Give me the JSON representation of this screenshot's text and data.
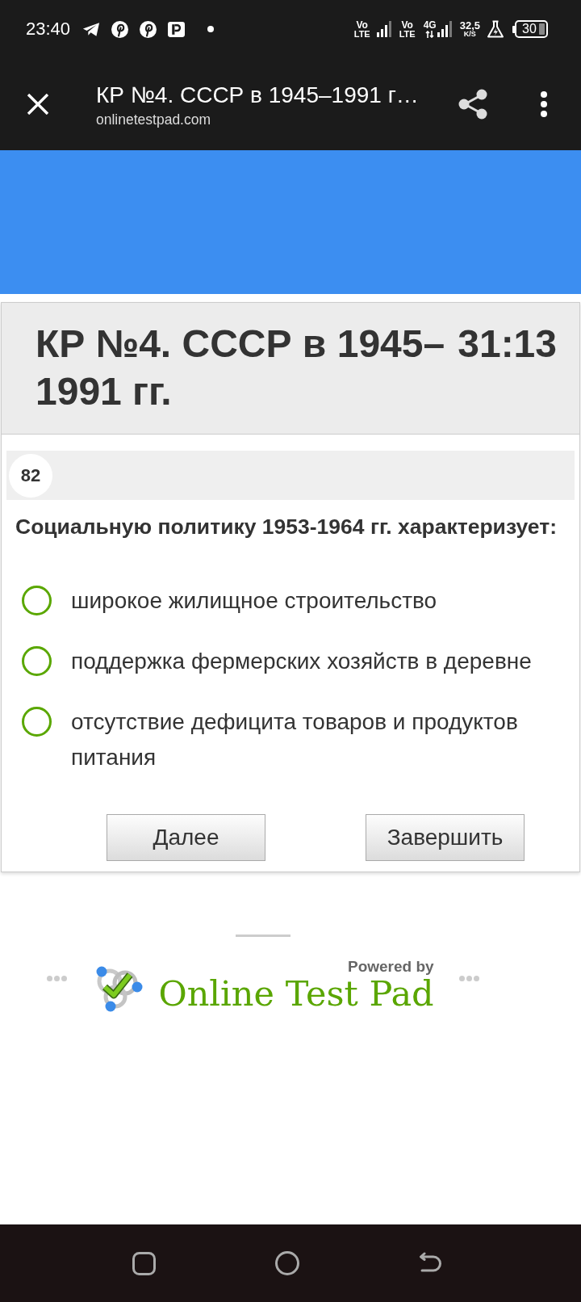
{
  "status_bar": {
    "time": "23:40",
    "sim_1": {
      "top": "Vo",
      "bottom": "LTE"
    },
    "sim_2": {
      "top": "Vo",
      "bottom": "LTE"
    },
    "network": "4G",
    "speed": {
      "value": "32,5",
      "unit": "K/S"
    },
    "battery": "30"
  },
  "browser_bar": {
    "title": "КР №4. СССР в 1945–1991 г…",
    "url": "onlinetestpad.com"
  },
  "test": {
    "title": "КР №4. СССР в 1945–1991 гг.",
    "timer": "31:13",
    "question": {
      "number": "82",
      "text": "Социальную политику 1953-1964 гг. характеризует:",
      "options": [
        {
          "label": "широкое жилищное строительство",
          "selected": false
        },
        {
          "label": "поддержка фермерских хозяйств в деревне",
          "selected": false
        },
        {
          "label": "отсутствие дефицита товаров и продуктов питания",
          "selected": false
        }
      ]
    },
    "buttons": [
      "Далее",
      "Завершить"
    ]
  },
  "footer": {
    "powered_by": "Powered by",
    "brand": "Online Test Pad"
  }
}
